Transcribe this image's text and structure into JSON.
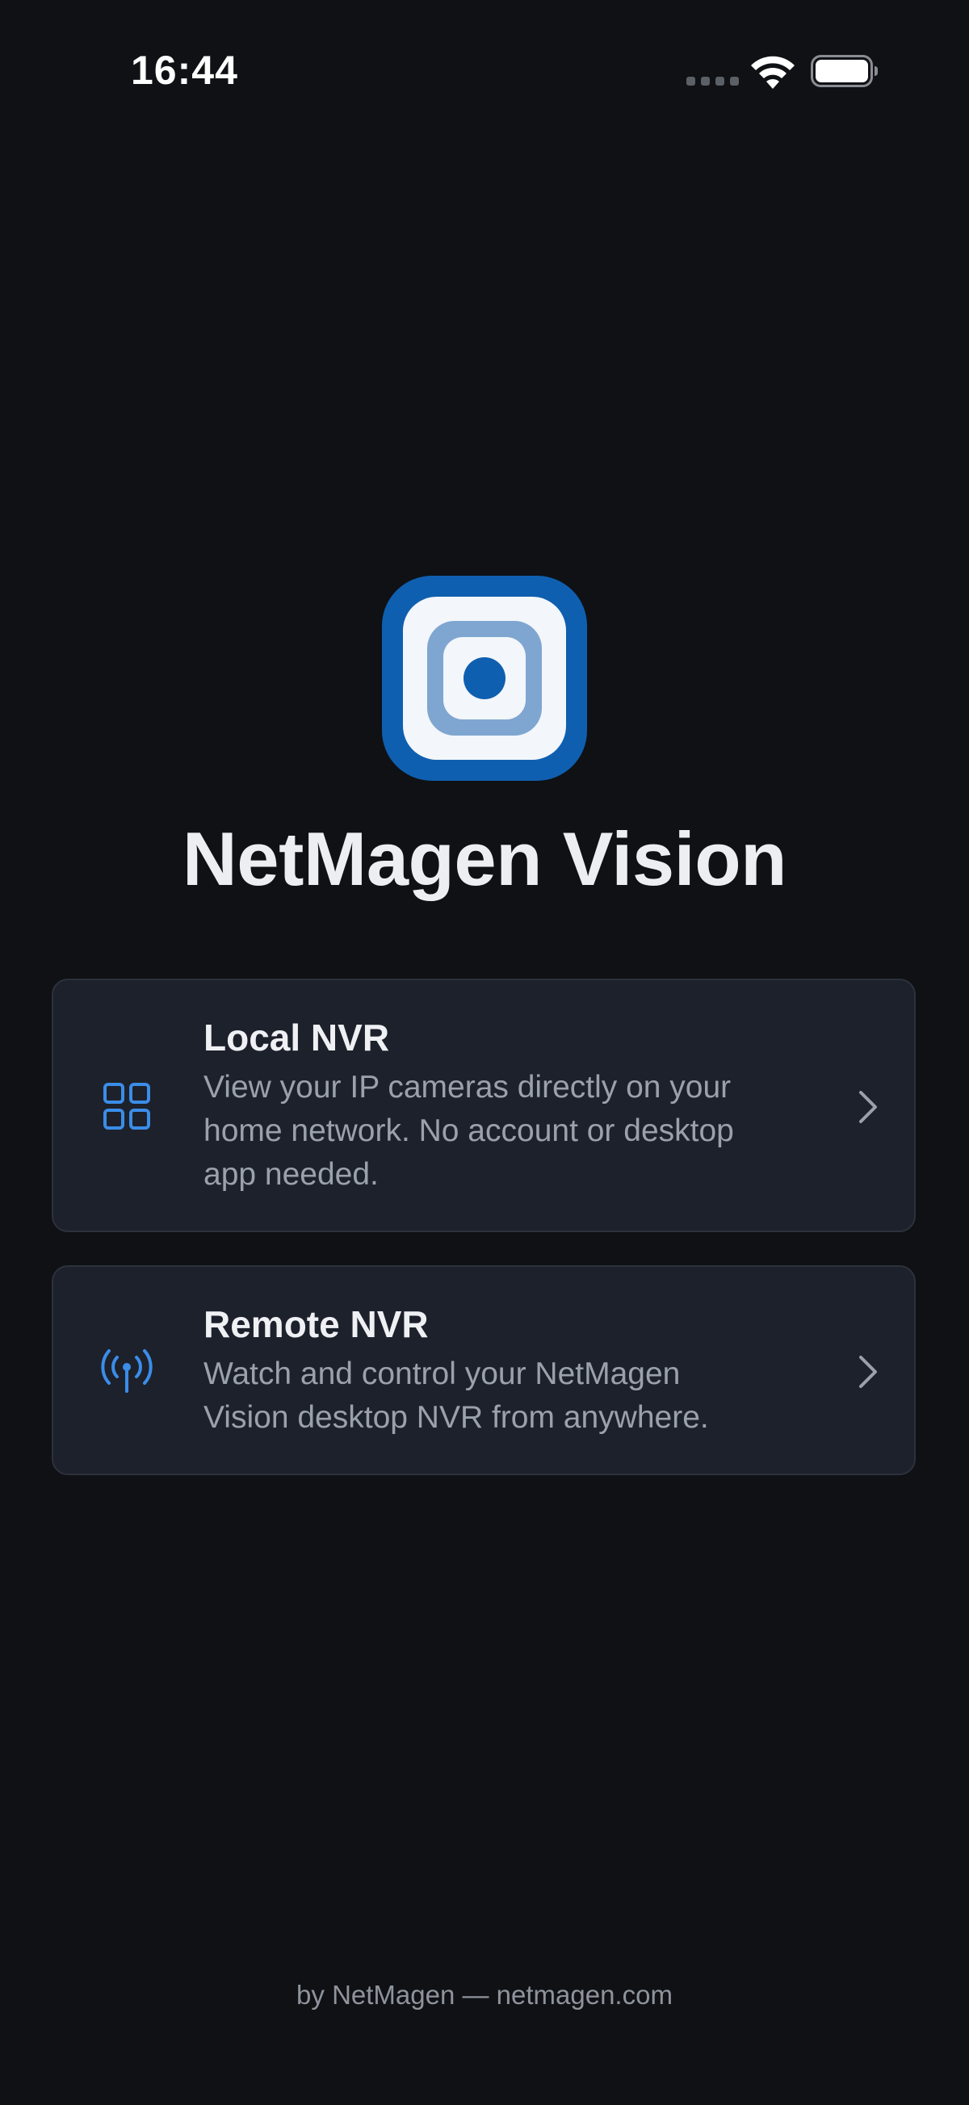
{
  "status_bar": {
    "time": "16:44",
    "icons": [
      "cellular-signal-icon",
      "wifi-icon",
      "battery-icon"
    ]
  },
  "app": {
    "logo_icon": "netmagen-camera-logo-icon",
    "title": "NetMagen Vision"
  },
  "options": [
    {
      "icon": "grid-icon",
      "title": "Local NVR",
      "description": "View your IP cameras directly on your home network. No account or desktop app needed.",
      "chevron": "chevron-right-icon"
    },
    {
      "icon": "antenna-broadcast-icon",
      "title": "Remote NVR",
      "description": "Watch and control your NetMagen Vision desktop NVR from anywhere.",
      "chevron": "chevron-right-icon"
    }
  ],
  "footer": {
    "text": "by NetMagen — netmagen.com"
  },
  "colors": {
    "background": "#0f1115",
    "card_background": "#1d212b",
    "card_border": "#2c313c",
    "accent_blue": "#3b8de8",
    "logo_blue": "#0f5fb0",
    "logo_ring": "#7fa6d1"
  }
}
